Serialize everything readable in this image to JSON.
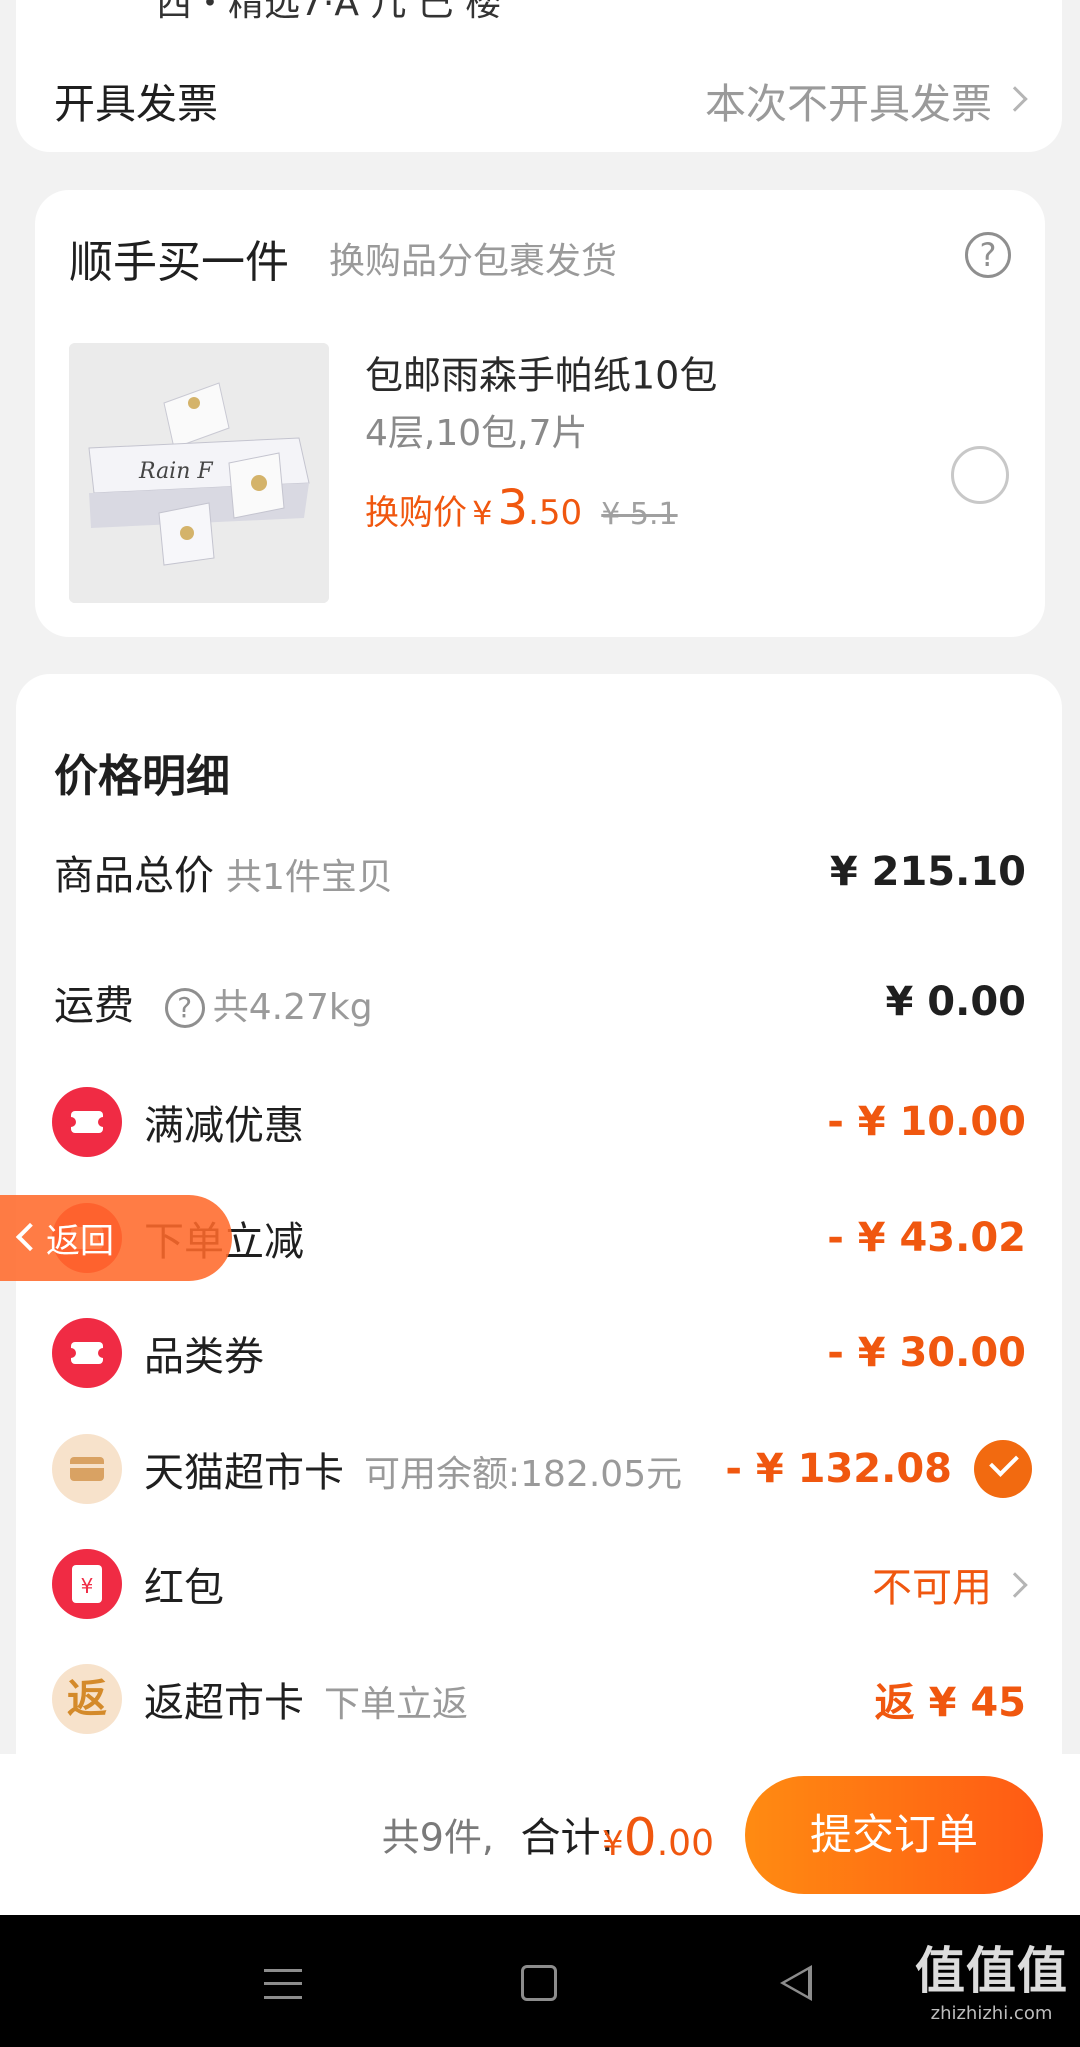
{
  "top_remnant": {
    "text": "西・精选7·A 几 巳 楼"
  },
  "invoice": {
    "label": "开具发票",
    "value": "本次不开具发票"
  },
  "addon": {
    "title": "顺手买一件",
    "subtitle": "换购品分包裹发货",
    "help_icon": "?",
    "product": {
      "name": "包邮雨森手帕纸10包",
      "spec": "4层,10包,7片",
      "price_label": "换购价",
      "currency": "¥",
      "price_int": "3",
      "price_dec": ".50",
      "original_price": "¥ 5.1"
    }
  },
  "details": {
    "heading": "价格明细",
    "rows": [
      {
        "label": "商品总价",
        "sub": "共1件宝贝",
        "amount": "¥ 215.10"
      },
      {
        "label": "运费",
        "sub": "共4.27kg",
        "amount": "¥ 0.00"
      },
      {
        "label": "满减优惠",
        "amount": "- ¥ 10.00",
        "icon": "coupon-icon"
      },
      {
        "label": "下单立减",
        "amount": "- ¥ 43.02",
        "icon": "coupon-icon"
      },
      {
        "label": "品类券",
        "amount": "- ¥ 30.00",
        "icon": "coupon-icon"
      },
      {
        "label": "天猫超市卡",
        "sub": "可用余额:182.05元",
        "amount": "- ¥ 132.08",
        "icon": "card-icon",
        "checked": true
      },
      {
        "label": "红包",
        "amount": "不可用",
        "icon": "red-envelope-icon"
      },
      {
        "label": "返超市卡",
        "sub": "下单立返",
        "amount": "返 ¥ 45",
        "icon_text": "返"
      }
    ]
  },
  "back_tab": {
    "label": "返回"
  },
  "bottom_bar": {
    "count": "共9件,",
    "total_label": "合计:",
    "currency": "¥",
    "total_int": "0",
    "total_dec": ".00",
    "submit": "提交订单"
  },
  "watermark": {
    "title": "值值值",
    "url": "zhizhizhi.com"
  },
  "colors": {
    "accent": "#f0570f",
    "coupon_red": "#f02b44",
    "check_orange": "#f26a10"
  }
}
